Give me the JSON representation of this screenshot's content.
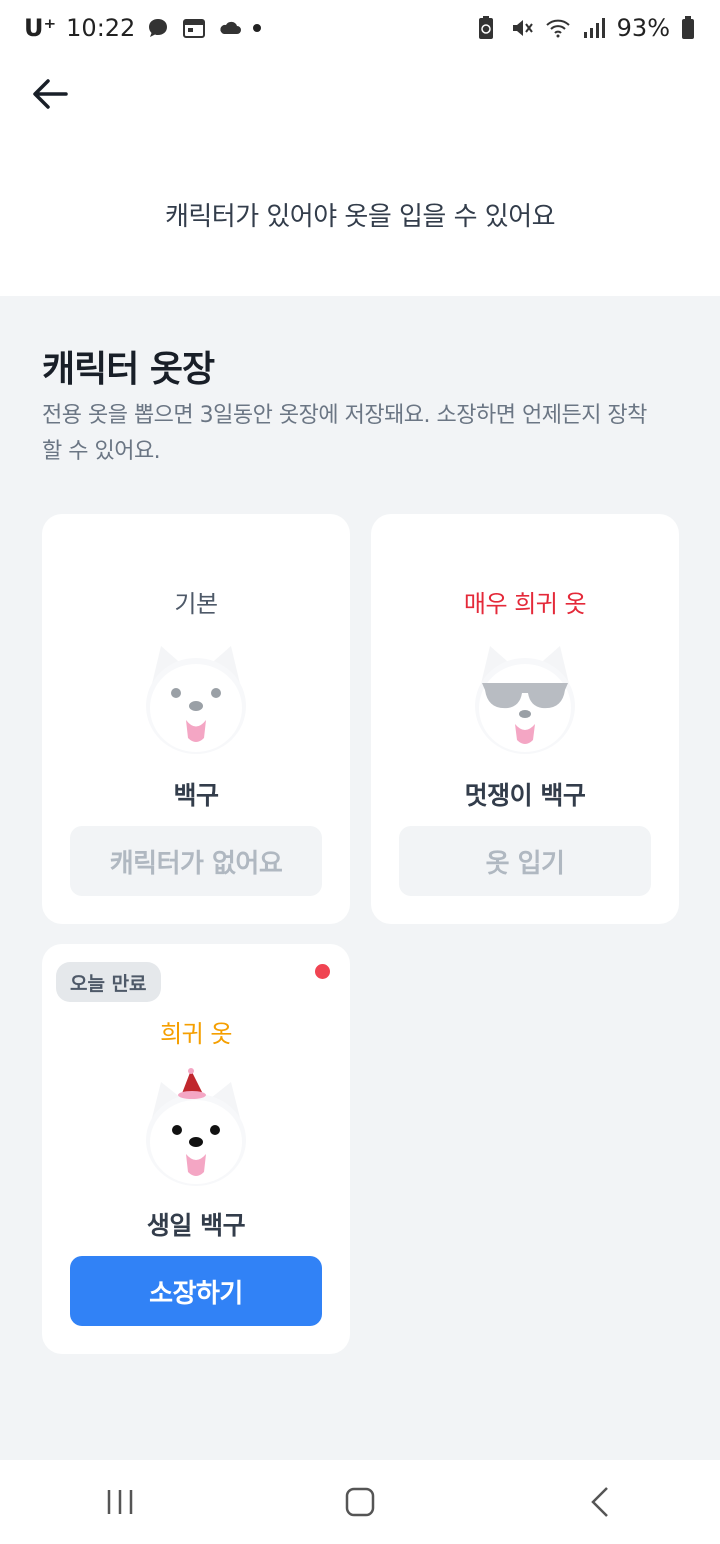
{
  "status_bar": {
    "carrier": "U⁺",
    "time": "10:22",
    "battery": "93%"
  },
  "notice": "캐릭터가 있어야 옷을 입을 수 있어요",
  "section": {
    "title": "캐릭터 옷장",
    "description": "전용 옷을 뽑으면 3일동안 옷장에 저장돼요. 소장하면 언제든지 장착할 수 있어요."
  },
  "cards": [
    {
      "rarity": "기본",
      "rarity_color": "#4e5968",
      "name": "백구",
      "button": "캐릭터가 없어요",
      "accessory": "none"
    },
    {
      "rarity": "매우 희귀 옷",
      "rarity_color": "#e42939",
      "name": "멋쟁이 백구",
      "button": "옷 입기",
      "accessory": "sunglasses"
    },
    {
      "badge": "오늘 만료",
      "rarity": "희귀 옷",
      "rarity_color": "#f59f00",
      "name": "생일 백구",
      "button": "소장하기",
      "accessory": "party-hat"
    }
  ],
  "colors": {
    "primary": "#3182f6",
    "background": "#f2f4f6",
    "alert_dot": "#f04452"
  }
}
